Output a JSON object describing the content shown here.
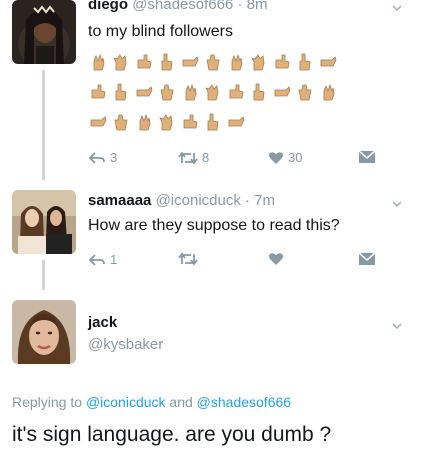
{
  "tweet1": {
    "name": "diego",
    "handle": "@shadesof666",
    "time": "· 8m",
    "text": "to my blind followers",
    "emoji_rows": [
      [
        "hand-1",
        "hand-2",
        "hand-3",
        "hand-4",
        "hand-5",
        "hand-6",
        "hand-7",
        "hand-8",
        "hand-9",
        "hand-10",
        "hand-11"
      ],
      [
        "hand-12",
        "hand-13",
        "hand-14",
        "hand-15",
        "hand-16",
        "hand-17",
        "hand-18",
        "hand-19",
        "hand-20",
        "hand-21",
        "hand-22"
      ],
      [
        "hand-23",
        "hand-24",
        "hand-25",
        "hand-26",
        "hand-27",
        "hand-28",
        "hand-29"
      ]
    ],
    "reply_count": "3",
    "retweet_count": "8",
    "like_count": "30"
  },
  "tweet2": {
    "name": "samaaaa",
    "handle": "@iconicduck",
    "time": "· 7m",
    "text": "How are they suppose to read this?",
    "reply_count": "1",
    "retweet_count": "",
    "like_count": ""
  },
  "tweet3": {
    "name": "jack",
    "handle": "@kysbaker",
    "replying_prefix": "Replying to",
    "mention1": "@iconicduck",
    "and_word": "and",
    "mention2": "@shadesof666",
    "text": "it's sign language. are you dumb ?"
  },
  "colors": {
    "text": "#14171a",
    "secondary": "#8899a6",
    "link": "#1da1f2",
    "thread_line": "#ccd6dd",
    "skin": "#e0b07a"
  },
  "icons": {
    "reply": "reply-icon",
    "retweet": "retweet-icon",
    "like": "heart-icon",
    "dm": "envelope-icon",
    "caret": "chevron-down-icon"
  }
}
